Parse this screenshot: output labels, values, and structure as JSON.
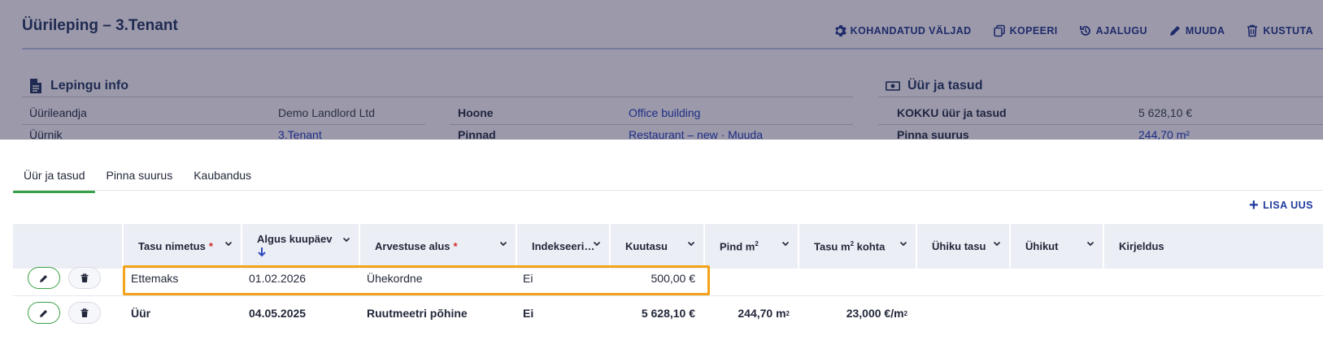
{
  "page": {
    "title": "Üürileping – 3.Tenant"
  },
  "actions": [
    {
      "label": "KOHANDATUD VÄLJAD",
      "icon": "gear-icon"
    },
    {
      "label": "KOPEERI",
      "icon": "copy-icon"
    },
    {
      "label": "AJALUGU",
      "icon": "history-icon"
    },
    {
      "label": "MUUDA",
      "icon": "pencil-icon"
    },
    {
      "label": "KUSTUTA",
      "icon": "trash-icon"
    }
  ],
  "contract_info": {
    "heading": "Lepingu info",
    "rows": [
      {
        "label": "Üürileandja",
        "value": "Demo Landlord Ltd",
        "label2": "Hoone",
        "value2": "Office building"
      },
      {
        "label": "Üürnik",
        "value": "3.Tenant",
        "label2": "Pinnad",
        "value2": "Restaurant – new · Muuda"
      }
    ]
  },
  "rent_fees": {
    "heading": "Üür ja tasud",
    "rows": [
      {
        "label": "KOKKU üür ja tasud",
        "value": "5 628,10 €"
      },
      {
        "label": "Pinna suurus",
        "value": "244,70 m²"
      }
    ]
  },
  "tabs": [
    {
      "label": "Üür ja tasud",
      "active": true
    },
    {
      "label": "Pinna suurus",
      "active": false
    },
    {
      "label": "Kaubandus",
      "active": false
    }
  ],
  "add_button": {
    "label": "LISA UUS"
  },
  "table": {
    "columns": [
      {
        "label": "Tasu nimetus",
        "required": true
      },
      {
        "label": "Algus kuupäev",
        "sorted": "desc"
      },
      {
        "label": "Arvestuse alus",
        "required": true
      },
      {
        "label": "Indekseeri…"
      },
      {
        "label": "Kuutasu"
      },
      {
        "label": "Pind m",
        "sup": "2"
      },
      {
        "label": "Tasu m",
        "sup": "2",
        "suffix": " kohta"
      },
      {
        "label": "Ühiku tasu"
      },
      {
        "label": "Ühikut"
      },
      {
        "label": "Kirjeldus"
      }
    ],
    "rows": [
      {
        "name": "Ettemaks",
        "start": "01.02.2026",
        "basis": "Ühekordne",
        "indexed": "Ei",
        "monthly": "500,00 €",
        "area": "",
        "area_unit": "",
        "rate": "",
        "highlighted": true,
        "bold": false
      },
      {
        "name": "Üür",
        "start": "04.05.2025",
        "basis": "Ruutmeetri põhine",
        "indexed": "Ei",
        "monthly": "5 628,10 €",
        "area": "244,70 m",
        "area_unit": "2",
        "rate": "23,000 €/m",
        "rate_unit": "2",
        "highlighted": false,
        "bold": true
      }
    ]
  },
  "colors": {
    "accent_green": "#3aa048",
    "highlight_orange": "#f2a31a",
    "link_blue": "#1d2c86",
    "overlay": "#9c9aaa"
  }
}
